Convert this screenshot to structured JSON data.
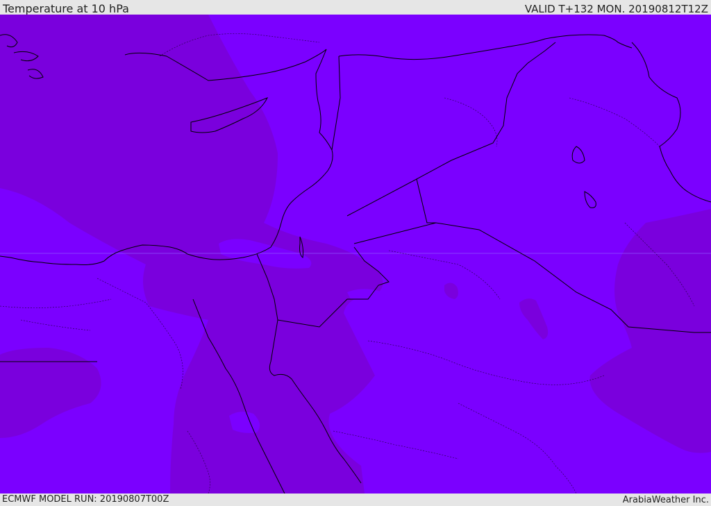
{
  "header": {
    "title": "Temperature at 10 hPa",
    "valid": "VALID T+132 MON. 20190812T12Z"
  },
  "footer": {
    "model_run": "ECMWF MODEL RUN: 20190807T00Z",
    "credit": "ArabiaWeather Inc."
  },
  "map": {
    "colors": {
      "field_light": "#7b00ff",
      "field_dark": "#7a00dd",
      "border": "#000000"
    }
  }
}
